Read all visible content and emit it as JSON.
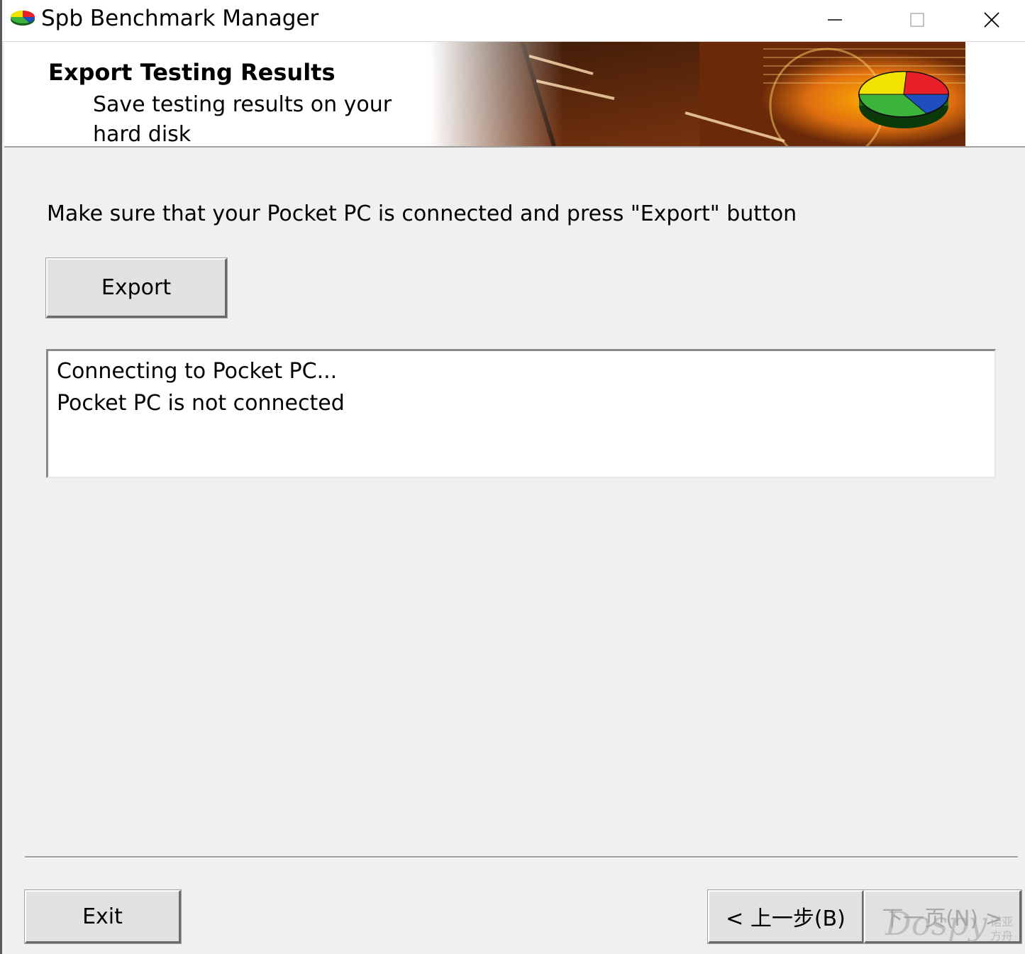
{
  "window": {
    "title": "Spb Benchmark Manager",
    "controls": {
      "minimize": "minimize",
      "maximize": "maximize",
      "close": "close"
    }
  },
  "header": {
    "title": "Export Testing Results",
    "subtitle": "Save testing results on your hard disk"
  },
  "main": {
    "instruction": "Make sure that your Pocket PC is connected and press \"Export\" button",
    "export_label": "Export",
    "log": [
      "Connecting to Pocket PC...",
      "Pocket PC is not connected"
    ]
  },
  "footer": {
    "exit_label": "Exit",
    "back_label": "< 上一步(B)",
    "next_label": "下一页(N) >"
  },
  "watermark": {
    "text": "Dospy",
    "sub": "诺亚方舟"
  },
  "colors": {
    "pie_yellow": "#f2e400",
    "pie_red": "#e8202a",
    "pie_blue": "#1f4fbf",
    "pie_green": "#3cb43c",
    "disabled_text": "#a8a8a8"
  }
}
